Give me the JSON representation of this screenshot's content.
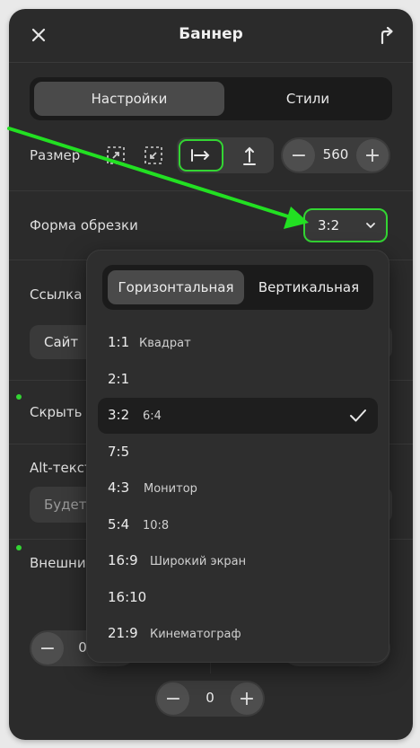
{
  "header": {
    "title": "Баннер",
    "close_icon": "close-icon",
    "share_icon": "share-icon"
  },
  "tabs": [
    {
      "label": "Настройки",
      "active": true
    },
    {
      "label": "Стили",
      "active": false
    }
  ],
  "size": {
    "label": "Размер",
    "value": "560",
    "minus": "−",
    "plus": "+"
  },
  "crop": {
    "label": "Форма обрезки",
    "value": "3:2"
  },
  "link": {
    "label": "Ссылка",
    "button": "Сайт"
  },
  "hide": {
    "label": "Скрыть д"
  },
  "alt": {
    "label": "Alt-текст",
    "placeholder": "Будет"
  },
  "appearance": {
    "label": "Внешние",
    "value_left": "0",
    "value_bottom": "0",
    "minus": "−",
    "plus": "+"
  },
  "dropdown": {
    "tabs": [
      {
        "label": "Горизонтальная",
        "active": true
      },
      {
        "label": "Вертикальная",
        "active": false
      }
    ],
    "options": [
      {
        "ratio": "1:1",
        "desc": "Квадрат",
        "selected": false
      },
      {
        "ratio": "2:1",
        "desc": "",
        "selected": false
      },
      {
        "ratio": "3:2",
        "desc": "6:4",
        "selected": true
      },
      {
        "ratio": "7:5",
        "desc": "",
        "selected": false
      },
      {
        "ratio": "4:3",
        "desc": "Монитор",
        "selected": false
      },
      {
        "ratio": "5:4",
        "desc": "10:8",
        "selected": false
      },
      {
        "ratio": "16:9",
        "desc": "Широкий экран",
        "selected": false
      },
      {
        "ratio": "16:10",
        "desc": "",
        "selected": false
      },
      {
        "ratio": "21:9",
        "desc": "Кинематограф",
        "selected": false
      }
    ]
  },
  "colors": {
    "panel": "#2b2b2b",
    "accent": "#33d533",
    "selected_row": "#1e1e1e"
  }
}
